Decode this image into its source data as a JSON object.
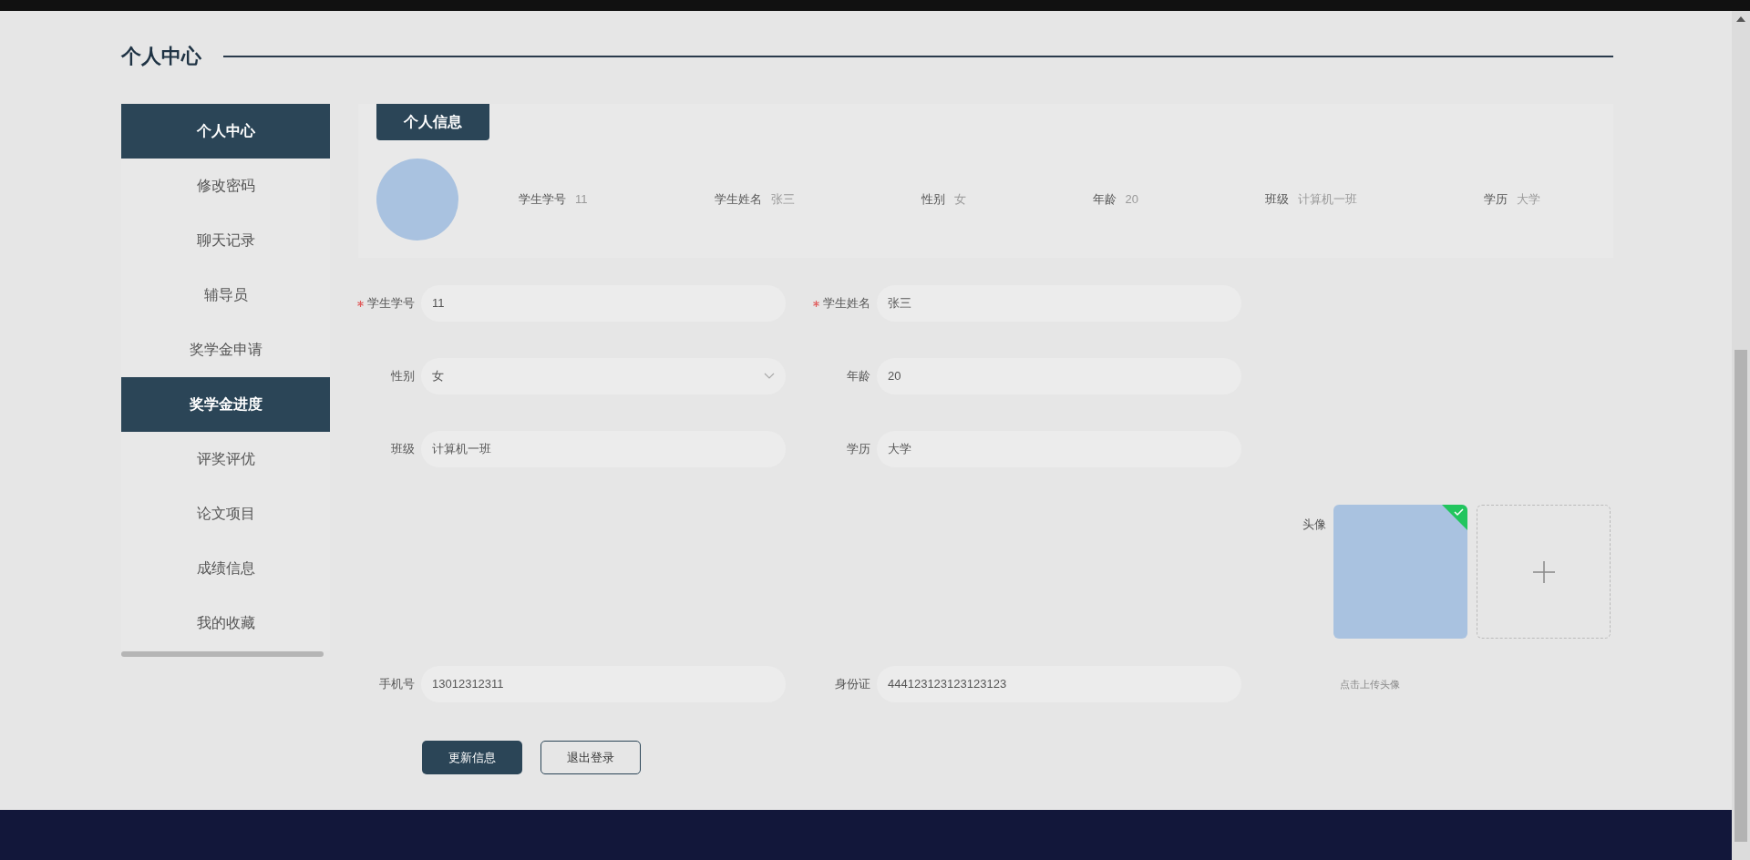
{
  "page_title": "个人中心",
  "sidebar": {
    "items": [
      {
        "label": "个人中心",
        "selected": true
      },
      {
        "label": "修改密码",
        "selected": false
      },
      {
        "label": "聊天记录",
        "selected": false
      },
      {
        "label": "辅导员",
        "selected": false
      },
      {
        "label": "奖学金申请",
        "selected": false
      },
      {
        "label": "奖学金进度",
        "selected": true
      },
      {
        "label": "评奖评优",
        "selected": false
      },
      {
        "label": "论文项目",
        "selected": false
      },
      {
        "label": "成绩信息",
        "selected": false
      },
      {
        "label": "我的收藏",
        "selected": false
      }
    ]
  },
  "profile_card": {
    "tab": "个人信息",
    "fields": [
      {
        "label": "学生学号",
        "value": "11"
      },
      {
        "label": "学生姓名",
        "value": "张三"
      },
      {
        "label": "性别",
        "value": "女"
      },
      {
        "label": "年龄",
        "value": "20"
      },
      {
        "label": "班级",
        "value": "计算机一班"
      },
      {
        "label": "学历",
        "value": "大学"
      }
    ]
  },
  "form": {
    "rows": [
      [
        {
          "label": "学生学号",
          "value": "11",
          "required": true,
          "kind": "text"
        },
        {
          "label": "学生姓名",
          "value": "张三",
          "required": true,
          "kind": "text"
        }
      ],
      [
        {
          "label": "性别",
          "value": "女",
          "required": false,
          "kind": "select"
        },
        {
          "label": "年龄",
          "value": "20",
          "required": false,
          "kind": "text"
        }
      ],
      [
        {
          "label": "班级",
          "value": "计算机一班",
          "required": false,
          "kind": "text"
        },
        {
          "label": "学历",
          "value": "大学",
          "required": false,
          "kind": "text"
        }
      ]
    ],
    "avatar": {
      "label": "头像",
      "uploaded": true,
      "hint": "点击上传头像"
    },
    "contact_row": [
      {
        "label": "手机号",
        "value": "13012312311",
        "required": false,
        "kind": "text"
      },
      {
        "label": "身份证",
        "value": "444123123123123123",
        "required": false,
        "kind": "text"
      }
    ]
  },
  "buttons": [
    {
      "label": "更新信息",
      "kind": "primary"
    },
    {
      "label": "退出登录",
      "kind": "outline"
    }
  ]
}
